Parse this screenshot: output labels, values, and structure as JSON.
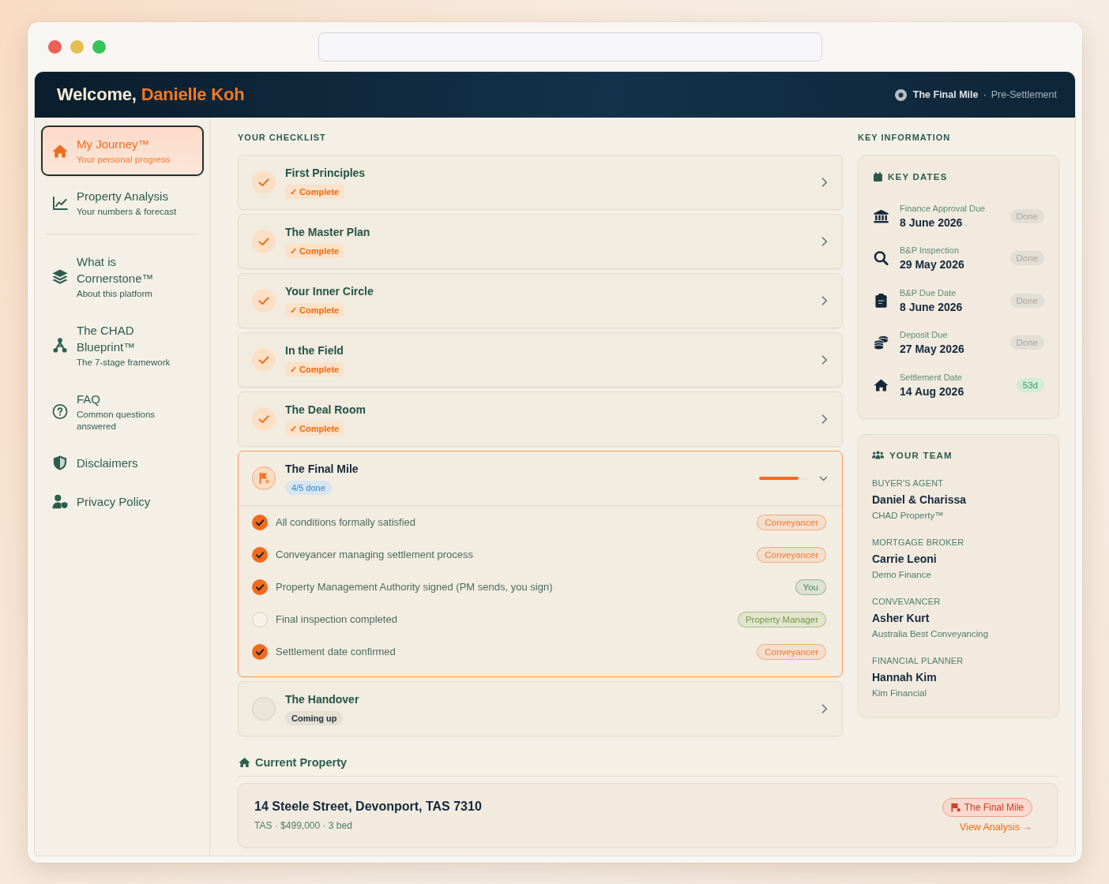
{
  "header": {
    "greeting": "Welcome,",
    "user_name": "Danielle Koh",
    "stage": "The Final Mile",
    "separator": "·",
    "phase": "Pre-Settlement"
  },
  "sidebar": {
    "primary_items": [
      {
        "title": "My Journey™",
        "subtitle": "Your personal progress",
        "selected": true
      },
      {
        "title": "Property Analysis",
        "subtitle": "Your numbers & forecast",
        "selected": false
      }
    ],
    "secondary_items": [
      {
        "title": "What is Cornerstone™",
        "subtitle": "About this platform",
        "selected": false
      },
      {
        "title": "The CHAD Blueprint™",
        "subtitle": "The 7-stage framework",
        "selected": false
      },
      {
        "title": "FAQ",
        "subtitle": "Common questions answered",
        "selected": false
      },
      {
        "title": "Disclaimers",
        "selected": false
      },
      {
        "title": "Privacy Policy",
        "selected": false
      }
    ]
  },
  "checklist": {
    "title": "YOUR CHECKLIST",
    "stages": [
      {
        "title": "First Principles",
        "kind": "complete",
        "badge": "✓ Complete",
        "expanded": false
      },
      {
        "title": "The Master Plan",
        "kind": "complete",
        "badge": "✓ Complete",
        "expanded": false
      },
      {
        "title": "Your Inner Circle",
        "kind": "complete",
        "badge": "✓ Complete",
        "expanded": false
      },
      {
        "title": "In the Field",
        "kind": "complete",
        "badge": "✓ Complete",
        "expanded": false
      },
      {
        "title": "The Deal Room",
        "kind": "complete",
        "badge": "✓ Complete",
        "expanded": false
      },
      {
        "title": "The Final Mile",
        "kind": "current",
        "badge": "4/5 done",
        "expanded": true,
        "level": 0.8,
        "tasks": [
          {
            "label": "All conditions formally satisfied",
            "checked": true,
            "owner": "Conveyancer",
            "color": "#ef7a35"
          },
          {
            "label": "Conveyancer managing settlement process",
            "checked": true,
            "owner": "Conveyancer",
            "color": "#ef7a35"
          },
          {
            "label": "Property Management Authority signed (PM sends, you sign)",
            "checked": true,
            "owner": "You",
            "color": "#3e8e60"
          },
          {
            "label": "Final inspection completed",
            "checked": false,
            "owner": "Property Manager",
            "color": "#6e9c40"
          },
          {
            "label": "Settlement date confirmed",
            "checked": true,
            "owner": "Conveyancer",
            "color": "#ef7a35"
          }
        ]
      },
      {
        "title": "The Handover",
        "kind": "upcoming",
        "badge": "Coming up",
        "expanded": false
      }
    ]
  },
  "key_information": {
    "title": "KEY INFORMATION",
    "key_dates": {
      "title": "KEY DATES",
      "items": [
        {
          "label": "Finance Approval Due",
          "date": "8 June 2026",
          "badge": "Done",
          "done": true
        },
        {
          "label": "B&P Inspection",
          "date": "29 May 2026",
          "badge": "Done",
          "done": true
        },
        {
          "label": "B&P Due Date",
          "date": "8 June 2026",
          "badge": "Done",
          "done": true
        },
        {
          "label": "Deposit Due",
          "date": "27 May 2026",
          "badge": "Done",
          "done": true
        },
        {
          "label": "Settlement Date",
          "date": "14 Aug 2026",
          "badge": "53d",
          "done": false
        }
      ]
    },
    "team": {
      "title": "YOUR TEAM",
      "members": [
        {
          "role": "BUYER'S AGENT",
          "name": "Daniel & Charissa",
          "company": "CHAD Property™"
        },
        {
          "role": "MORTGAGE BROKER",
          "name": "Carrie Leoni",
          "company": "Demo Finance"
        },
        {
          "role": "CONVEVANCER",
          "name": "Asher Kurt",
          "company": "Australia Best Conveyancing"
        },
        {
          "role": "FINANCIAL PLANNER",
          "name": "Hannah Kim",
          "company": "Kim Financial"
        }
      ]
    }
  },
  "current_property": {
    "title": "Current Property",
    "address": "14 Steele Street, Devonport, TAS 7310",
    "details": "TAS · $499,000 · 3 bed",
    "stage_tag": "The Final Mile",
    "link": "View Analysis →"
  }
}
